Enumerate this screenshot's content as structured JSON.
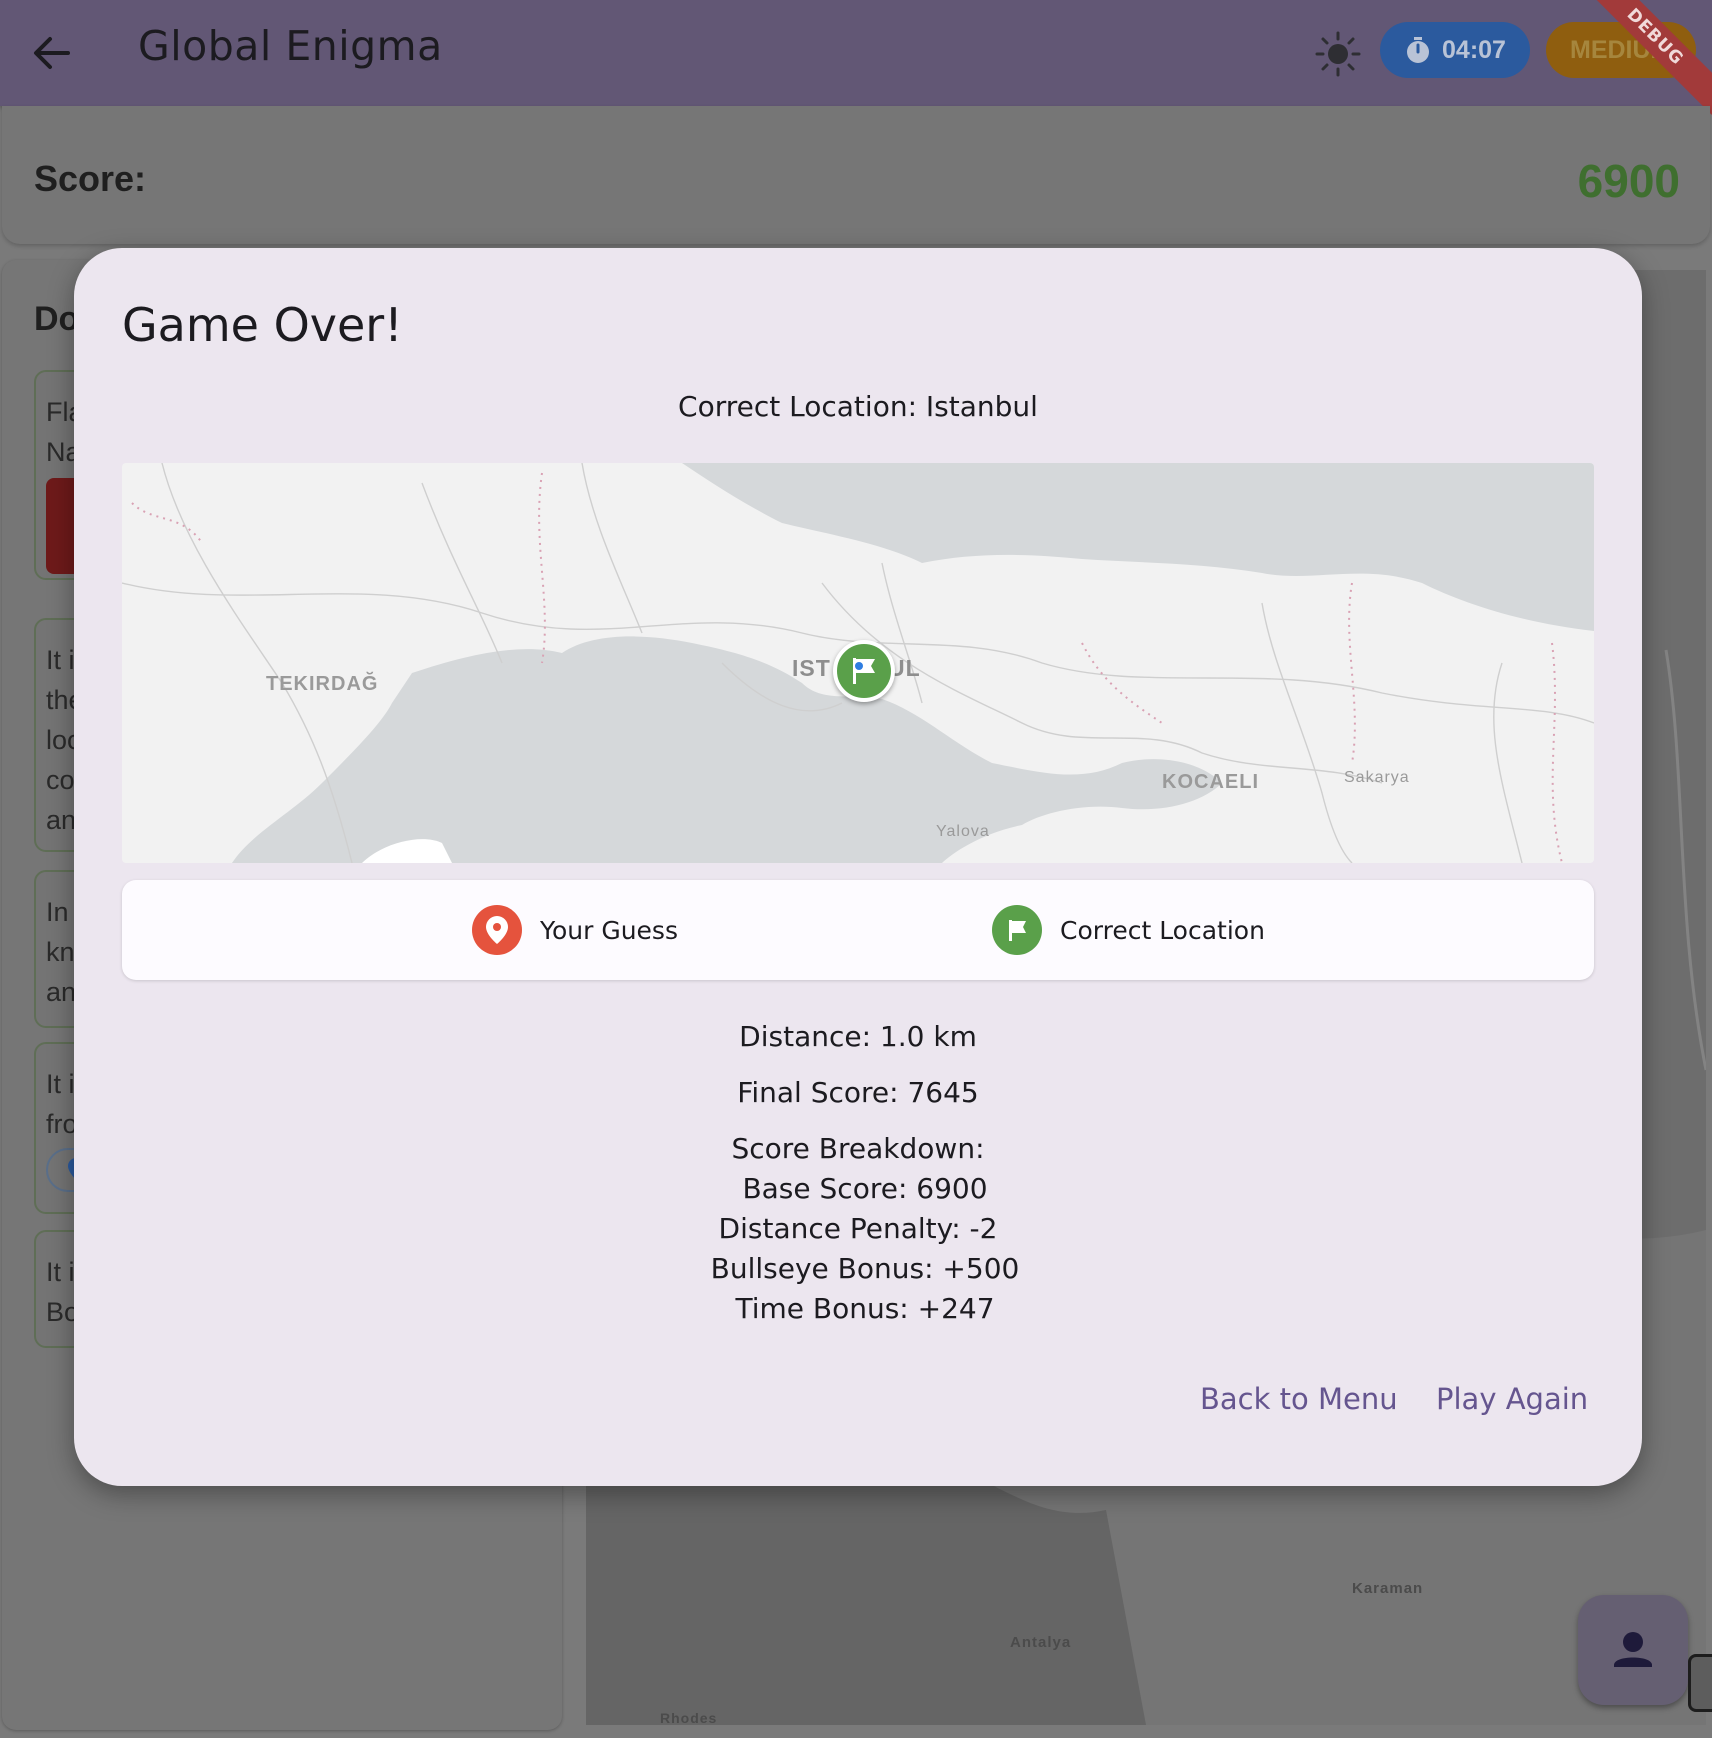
{
  "app": {
    "title": "Global Enigma",
    "timer": "04:07",
    "difficulty": "MEDIUM",
    "debug_label": "DEBUG"
  },
  "score_bar": {
    "label": "Score:",
    "value": "6900"
  },
  "background": {
    "left_heading": "Do",
    "hint_fragments": [
      [
        "Fla",
        "Na"
      ],
      [
        "It i",
        "the",
        "loc",
        "co",
        "an"
      ],
      [
        "In",
        "kn",
        "an"
      ],
      [
        "It i",
        "fro"
      ],
      [
        "It i",
        "Bo"
      ]
    ],
    "map_labels": [
      "Karaman",
      "Antalya",
      "Rhodes"
    ]
  },
  "dialog": {
    "title": "Game Over!",
    "correct_location_line": "Correct Location: Istanbul",
    "map": {
      "labels": {
        "tekirdag": "TEKIRDAĞ",
        "istanbul_left": "IST",
        "istanbul_right": "UL",
        "kocaeli": "KOCAELI",
        "sakarya": "Sakarya",
        "yalova": "Yalova"
      }
    },
    "legend": {
      "guess_label": "Your Guess",
      "correct_label": "Correct Location"
    },
    "distance": "Distance: 1.0 km",
    "final_score": "Final Score: 7645",
    "breakdown_heading": "Score Breakdown:",
    "breakdown": {
      "base": "Base Score: 6900",
      "distance_penalty": "Distance Penalty: -2",
      "bullseye": "Bullseye Bonus: +500",
      "time": "Time Bonus: +247"
    },
    "buttons": {
      "back_to_menu": "Back to Menu",
      "play_again": "Play Again"
    }
  },
  "colors": {
    "appbar": "#625775",
    "score_value": "#3f6f2f",
    "guess_marker": "#e5533d",
    "correct_marker": "#5aa04a",
    "dialog_bg": "#ece6ef",
    "accent_text": "#65558f"
  },
  "icons": {
    "back": "arrow-left-icon",
    "theme": "sun-icon",
    "timer": "stopwatch-icon",
    "guess": "map-pin-icon",
    "correct": "flag-icon",
    "profile": "person-icon"
  }
}
